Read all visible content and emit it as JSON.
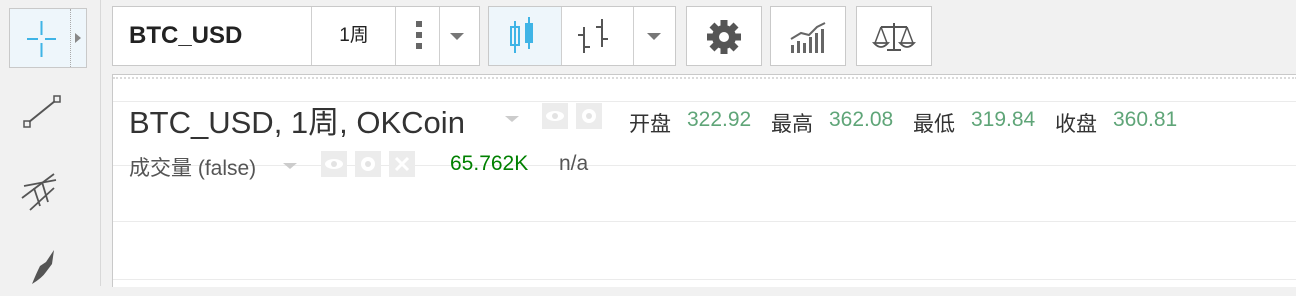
{
  "toolbar": {
    "symbol": "BTC_USD",
    "interval": "1周"
  },
  "legend": {
    "title": "BTC_USD, 1周, OKCoin",
    "open_label": "开盘",
    "open_value": "322.92",
    "high_label": "最高",
    "high_value": "362.08",
    "low_label": "最低",
    "low_value": "319.84",
    "close_label": "收盘",
    "close_value": "360.81",
    "value_color": "#5fa578"
  },
  "volume": {
    "title": "成交量 (false)",
    "value": "65.762K",
    "na": "n/a",
    "value_color": "#008000"
  },
  "icons": {
    "left_tools": [
      "crosshair-icon",
      "trend-line-icon",
      "pitchfork-icon",
      "brush-icon"
    ],
    "top_buttons": [
      "candles-icon",
      "bar-style-icon",
      "settings-gear-icon",
      "indicators-icon",
      "compare-scale-icon"
    ]
  },
  "colors": {
    "accent": "#3fb4e6",
    "active_bg": "#eef6fb"
  }
}
